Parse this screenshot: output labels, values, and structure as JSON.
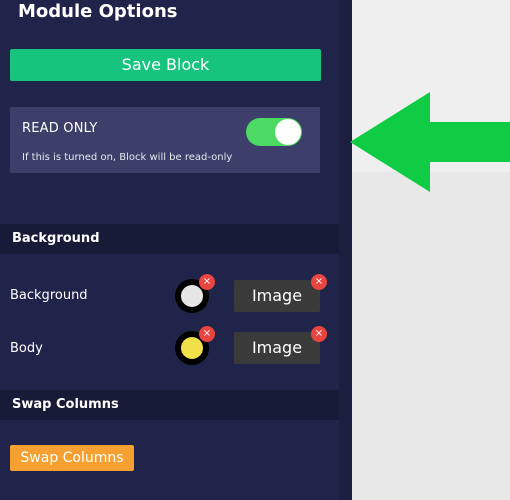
{
  "panel": {
    "title": "Module Options",
    "save_button": "Save Block",
    "read_only": {
      "label": "READ ONLY",
      "help": "If this is turned on, Block will be read-only",
      "enabled": true
    },
    "background_section": {
      "header": "Background",
      "rows": [
        {
          "label": "Background",
          "swatch_color": "#e6e6e6",
          "image_button": "Image",
          "remove_icon": "×"
        },
        {
          "label": "Body",
          "swatch_color": "#f2e04a",
          "image_button": "Image",
          "remove_icon": "×"
        }
      ]
    },
    "swap_section": {
      "header": "Swap Columns",
      "button": "Swap Columns"
    }
  },
  "colors": {
    "panel_bg": "#20244a",
    "accent_green": "#16c47e",
    "toggle_on": "#4cd964",
    "swap_orange": "#f5a030",
    "arrow_green": "#10cc44",
    "remove_red": "#e9453f"
  }
}
